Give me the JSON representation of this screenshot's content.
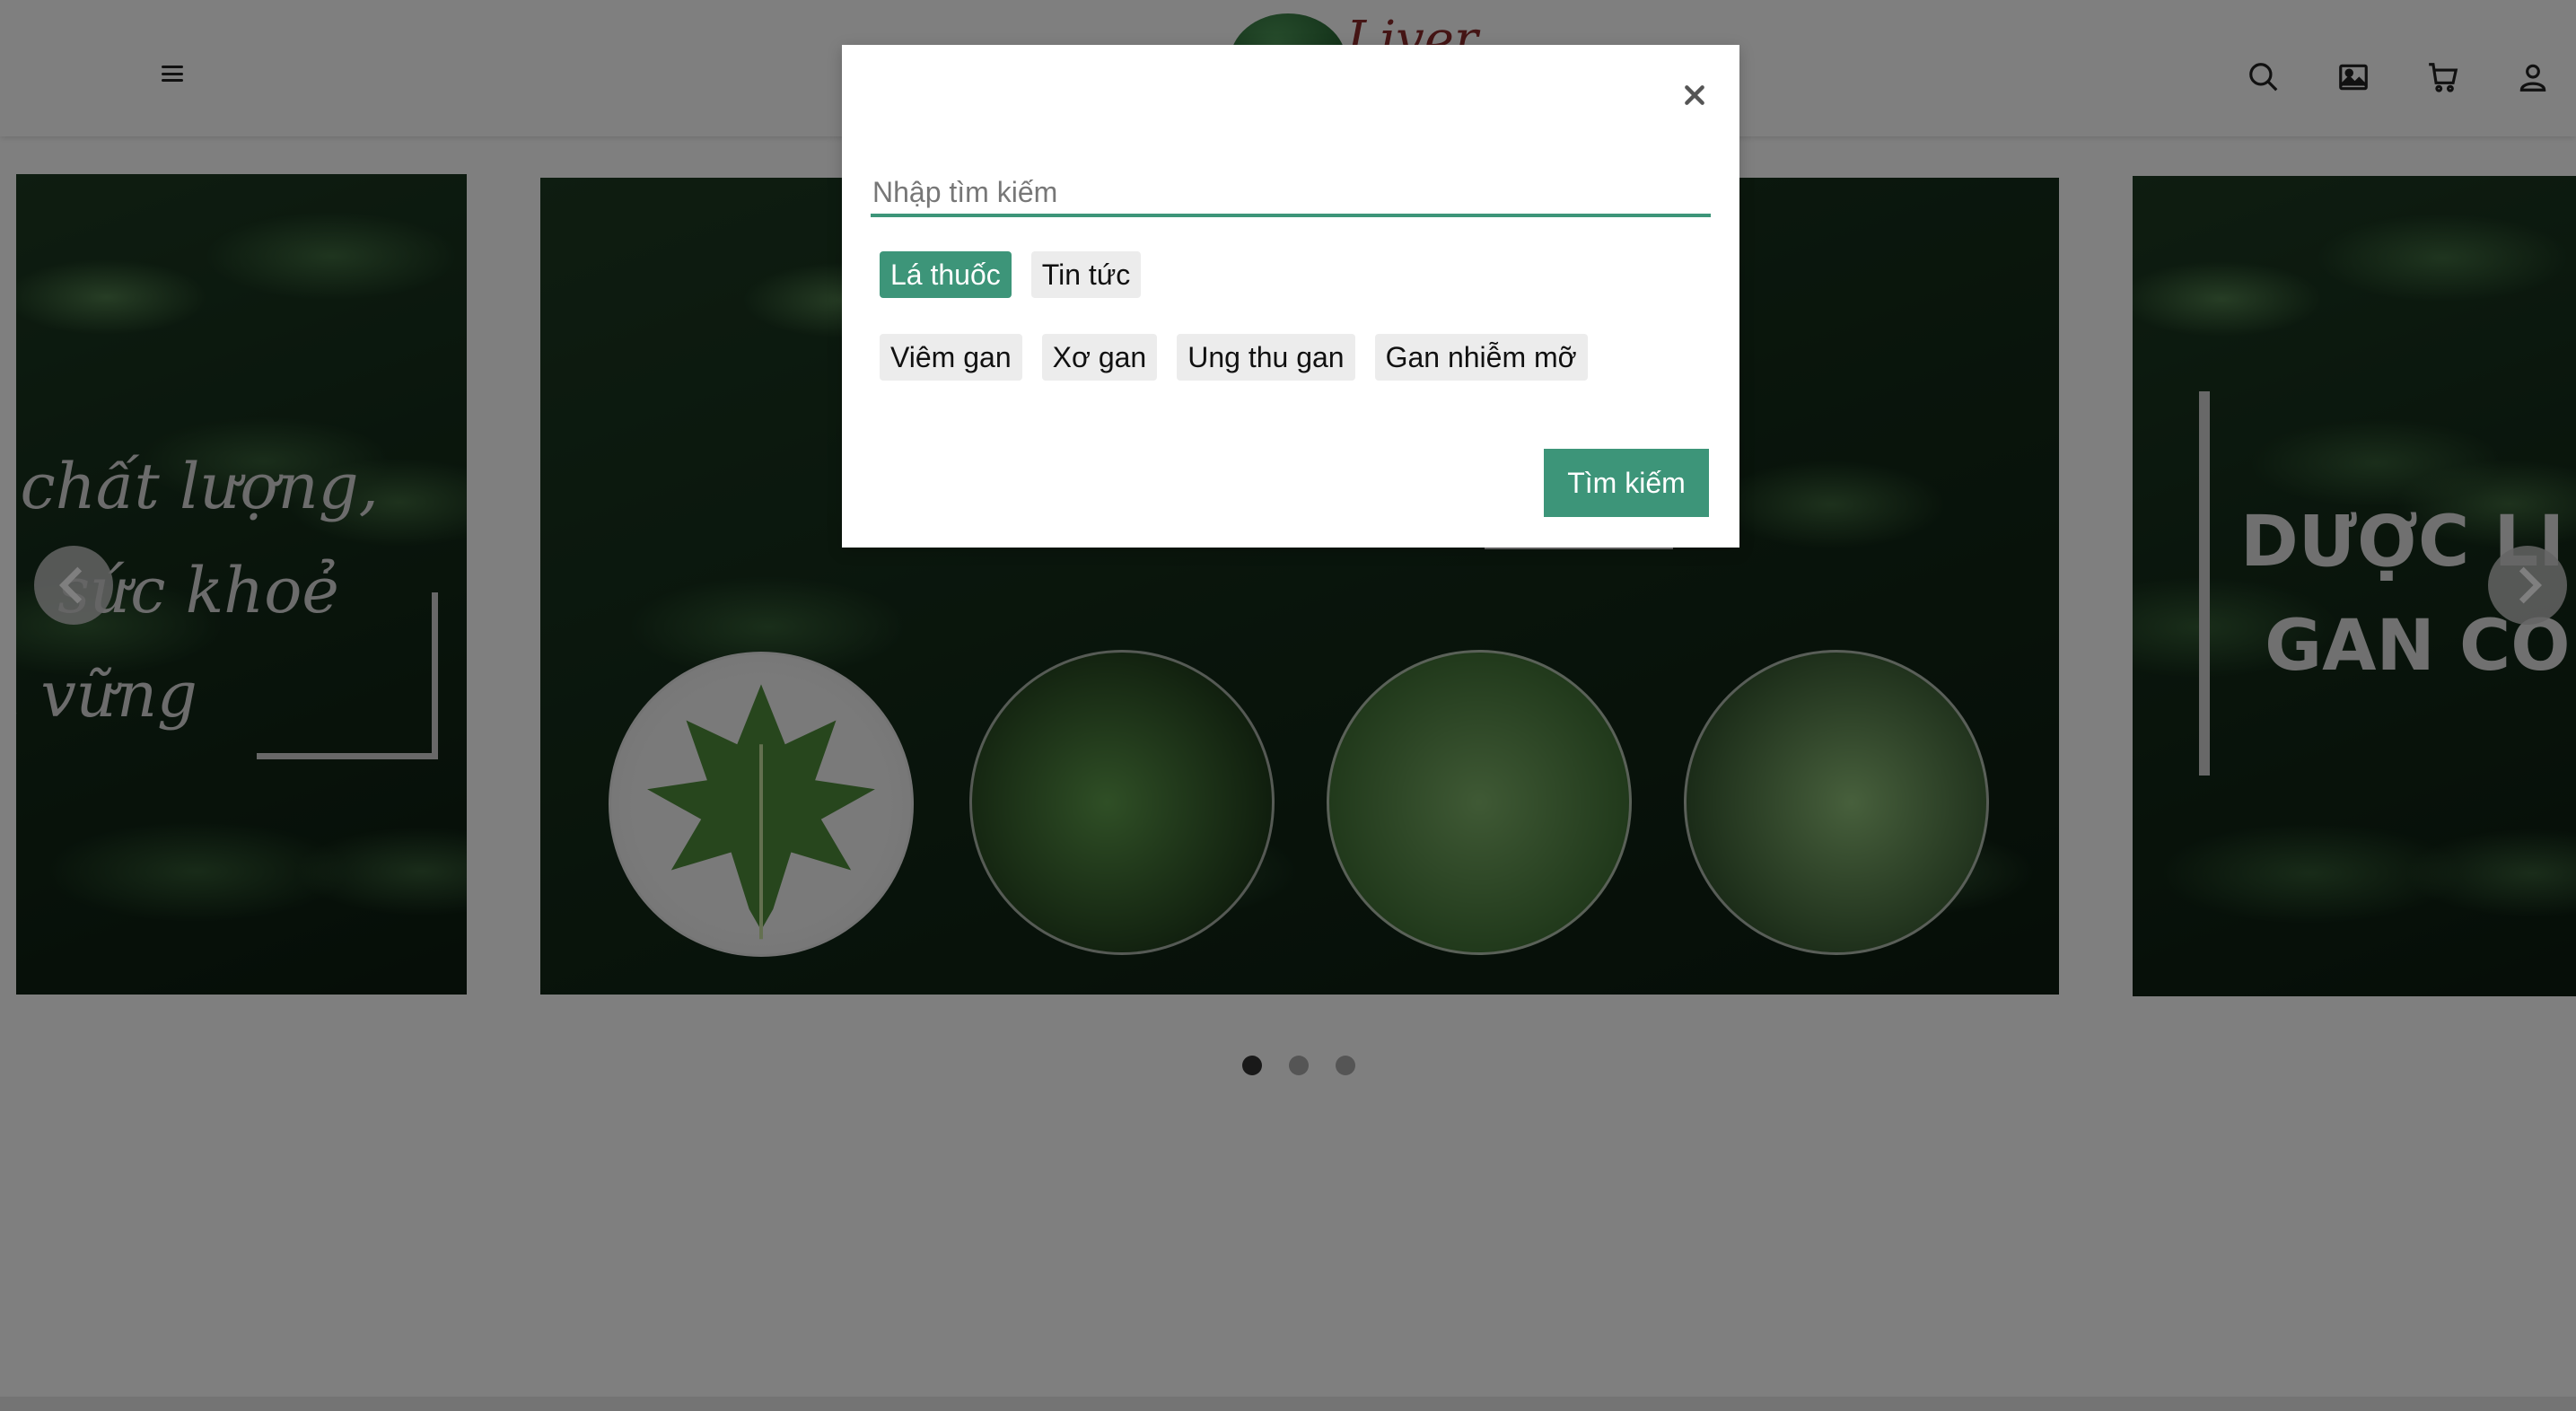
{
  "header": {
    "logo_text": "Liver",
    "icons": [
      "menu-icon",
      "search-icon",
      "image-icon",
      "cart-icon",
      "user-icon"
    ]
  },
  "slider": {
    "left_slide_text": ", chất lượng,\nả  sức khoẻ\nn vững",
    "right_slide_text": "DƯỢC LI\n GAN CO",
    "dots_count": 3,
    "active_dot": 1
  },
  "search_modal": {
    "placeholder": "Nhập tìm kiếm",
    "value": "",
    "categories": [
      {
        "label": "Lá thuốc",
        "active": true
      },
      {
        "label": "Tin tức",
        "active": false
      }
    ],
    "tags": [
      "Viêm gan",
      "Xơ gan",
      "Ung thu gan",
      "Gan nhiễm mỡ"
    ],
    "submit_label": "Tìm kiếm",
    "close_icon": "close-icon"
  },
  "colors": {
    "accent": "#3d9579",
    "overlay": "rgba(0,0,0,0.5)"
  }
}
